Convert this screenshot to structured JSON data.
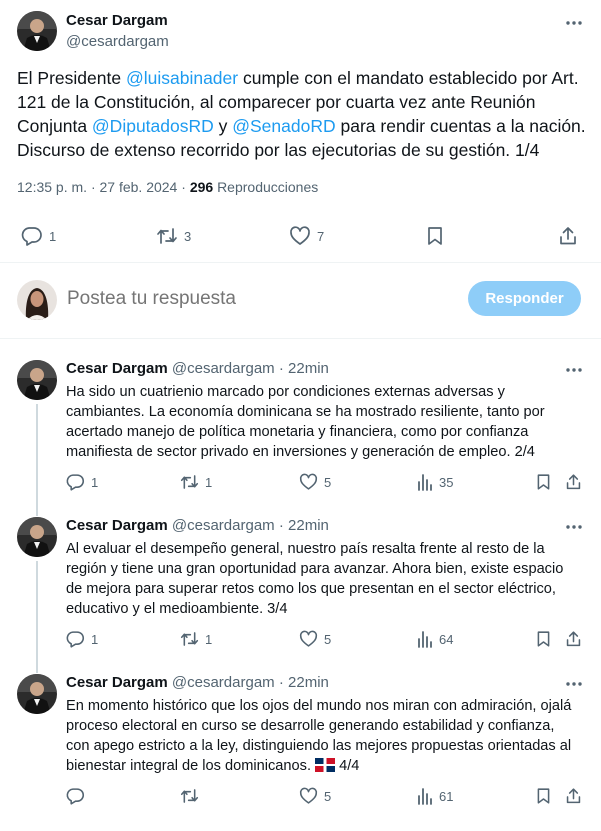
{
  "main_tweet": {
    "author_name": "Cesar Dargam",
    "handle": "@cesardargam",
    "text": {
      "t1": "El Presidente ",
      "m1": "@luisabinader",
      "t2": " cumple con el mandato establecido por Art. 121 de la Constitución, al comparecer por cuarta vez ante Reunión Conjunta ",
      "m2": "@DiputadosRD",
      "t3": " y ",
      "m3": "@SenadoRD",
      "t4": " para rendir cuentas a la nación. Discurso de extenso recorrido por las ejecutorias de su gestión. 1/4"
    },
    "time": "12:35 p. m.",
    "sep": "·",
    "date": "27 feb. 2024",
    "views_count": "296",
    "views_label": "Reproducciones",
    "replies": "1",
    "retweets": "3",
    "likes": "7"
  },
  "reply_box": {
    "placeholder": "Postea tu respuesta",
    "button": "Responder"
  },
  "replies": [
    {
      "name": "Cesar Dargam",
      "handle": "@cesardargam",
      "sep": "·",
      "time": "22min",
      "text": "Ha sido un cuatrienio marcado por condiciones externas adversas y cambiantes. La economía dominicana se ha mostrado resiliente, tanto por acertado manejo de política monetaria y financiera, como por confianza manifiesta de sector privado en inversiones y generación de empleo. 2/4",
      "replies": "1",
      "retweets": "1",
      "likes": "5",
      "views": "35"
    },
    {
      "name": "Cesar Dargam",
      "handle": "@cesardargam",
      "sep": "·",
      "time": "22min",
      "text": "Al evaluar el desempeño general, nuestro país resalta frente al resto de la región y tiene una gran oportunidad para avanzar. Ahora bien, existe espacio de mejora para superar retos como los que presentan en el sector eléctrico, educativo y el medioambiente. 3/4",
      "replies": "1",
      "retweets": "1",
      "likes": "5",
      "views": "64"
    },
    {
      "name": "Cesar Dargam",
      "handle": "@cesardargam",
      "sep": "·",
      "time": "22min",
      "text": "En momento histórico que los ojos del mundo nos miran con admiración, ojalá proceso electoral en curso se desarrolle generando estabilidad y confianza, con apego estricto a la ley, distinguiendo las mejores propuestas orientadas al bienestar integral de los dominicanos.",
      "suffix": "4/4",
      "flag": "dominican-republic-flag",
      "replies": "",
      "retweets": "",
      "likes": "5",
      "views": "61"
    }
  ],
  "colors": {
    "accent": "#1d9bf0",
    "text": "#0f1419",
    "muted": "#536471",
    "button_disabled": "#8ecdf8",
    "divider": "#eff3f4"
  }
}
